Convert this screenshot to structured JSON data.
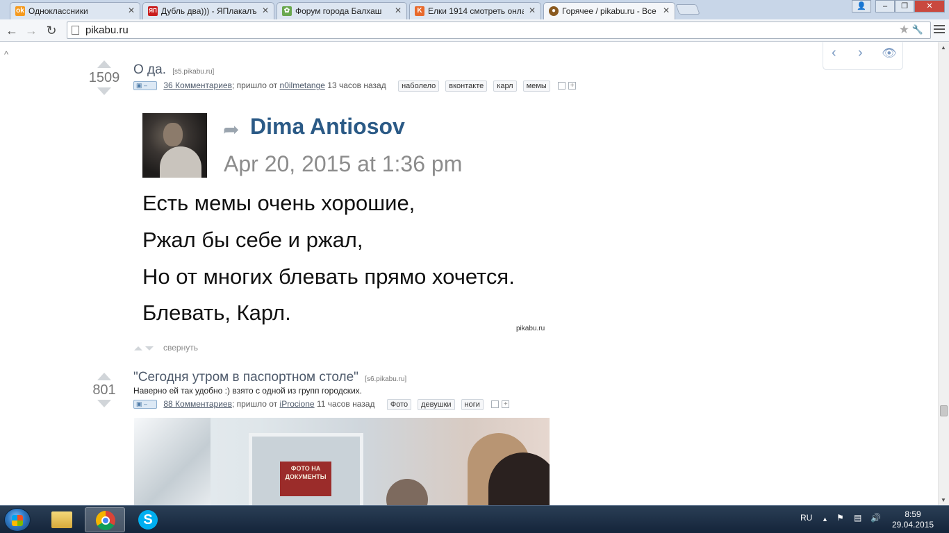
{
  "tabs": [
    {
      "title": "Одноклассники",
      "favicon_color": "#f59a1f",
      "favicon_glyph": "ok"
    },
    {
      "title": "Дубль два))) - ЯПлакалъ",
      "favicon_color": "#c91d1d",
      "favicon_glyph": "ЯП"
    },
    {
      "title": "Форум города Балхаш",
      "favicon_color": "#6aa84f",
      "favicon_glyph": "✿"
    },
    {
      "title": "Елки 1914 смотреть онла",
      "favicon_color": "#e8692b",
      "favicon_glyph": "K"
    },
    {
      "title": "Горячее / pikabu.ru - Все",
      "favicon_color": "#8a5a20",
      "favicon_glyph": "●"
    }
  ],
  "address_bar": {
    "url": "pikabu.ru"
  },
  "posts": [
    {
      "score": "1509",
      "title": "О да.",
      "source": "[s5.pikabu.ru]",
      "comments": "36 Комментариев",
      "from_text": "; пришло от",
      "author": "n0ilmetange",
      "time": "13 часов назад",
      "tags": [
        "наболело",
        "вконтакте",
        "карл",
        "мемы"
      ],
      "image": {
        "author": "Dima Antiosov",
        "date": "Apr 20, 2015 at 1:36 pm",
        "lines": [
          "Есть мемы очень хорошие,",
          "Ржал бы себе и ржал,",
          "Но от многих блевать прямо хочется.",
          "Блевать, Карл."
        ],
        "watermark": "pikabu.ru"
      },
      "collapse_label": "свернуть"
    },
    {
      "score": "801",
      "title": "\"Сегодня утром в паспортном столе\"",
      "source": "[s6.pikabu.ru]",
      "description": "Наверно ей так удобно :) взято с одной из групп городских.",
      "comments": "88 Комментариев",
      "from_text": "; пришло от",
      "author": "iProcione",
      "time": "11 часов назад",
      "tags": [
        "Фото",
        "девушки",
        "ноги"
      ],
      "image": {
        "sign_text": "ФОТО НА ДОКУМЕНТЫ"
      }
    }
  ],
  "taskbar": {
    "language": "RU",
    "time": "8:59",
    "date": "29.04.2015"
  },
  "colors": {
    "link": "#4e5a6b",
    "author_blue": "#2b5a86",
    "nav_arrow": "#7a99c2"
  }
}
